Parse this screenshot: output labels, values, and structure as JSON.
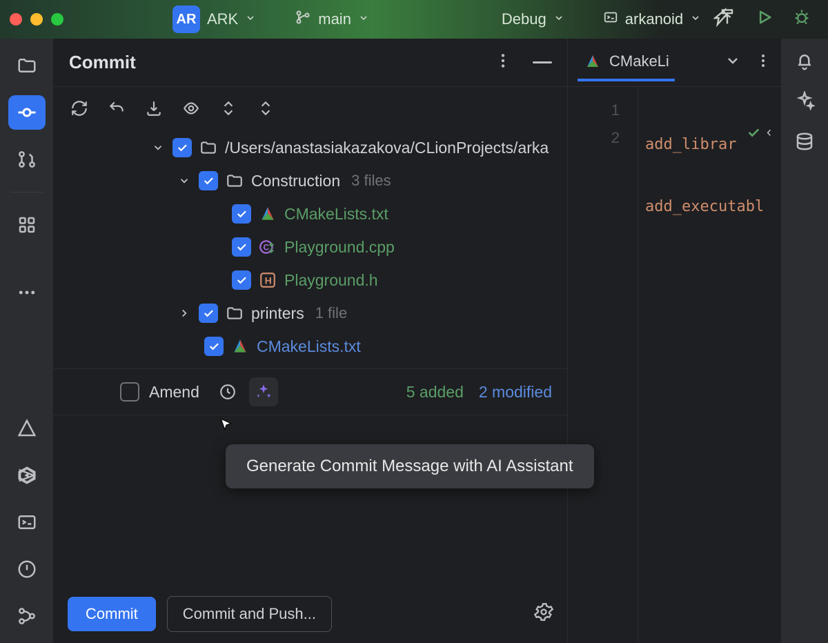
{
  "titlebar": {
    "project_badge": "AR",
    "project_name": "ARK",
    "branch": "main",
    "config": "Debug",
    "target": "arkanoid"
  },
  "commit_panel": {
    "title": "Commit",
    "root_path": "/Users/anastasiakazakova/CLionProjects/arka",
    "folders": {
      "construction": {
        "name": "Construction",
        "meta": "3 files"
      },
      "printers": {
        "name": "printers",
        "meta": "1 file"
      }
    },
    "files": {
      "cmake1": "CMakeLists.txt",
      "playground_cpp": "Playground.cpp",
      "playground_h": "Playground.h",
      "cmake2": "CMakeLists.txt"
    },
    "amend_label": "Amend",
    "status": {
      "added": "5 added",
      "modified": "2 modified"
    },
    "tooltip": "Generate Commit Message with AI Assistant",
    "buttons": {
      "commit": "Commit",
      "commit_push": "Commit and Push..."
    }
  },
  "editor": {
    "tab_label": "CMakeLi",
    "gutter": {
      "l1": "1",
      "l2": "2"
    },
    "code": {
      "l1": "add_librar",
      "l2": "add_executabl"
    }
  }
}
